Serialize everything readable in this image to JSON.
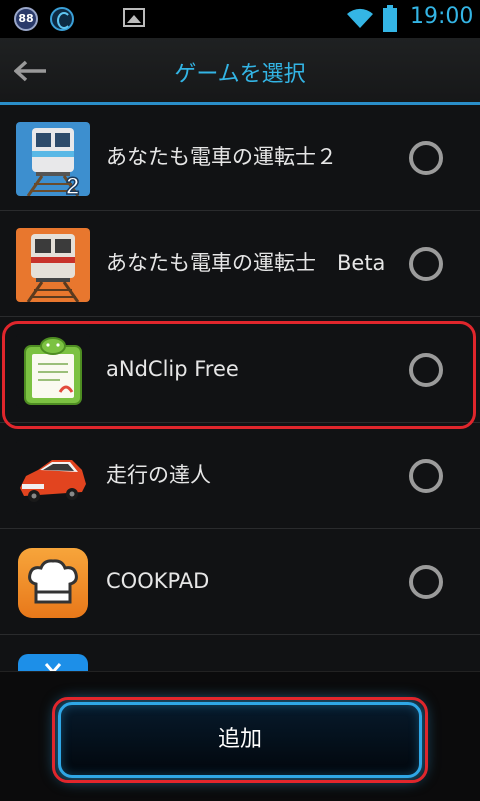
{
  "status_bar": {
    "badge": "88",
    "time": "19:00",
    "icons": [
      "app-badge-icon",
      "app-swirl-icon",
      "image-icon",
      "wifi-icon",
      "battery-icon"
    ]
  },
  "header": {
    "title": "ゲームを選択",
    "back_icon": "back-arrow-icon"
  },
  "games": [
    {
      "label": "あなたも電車の運転士２",
      "icon": "train-2-icon",
      "selected": false
    },
    {
      "label": "あなたも電車の運転士　Beta",
      "icon": "train-beta-icon",
      "selected": false
    },
    {
      "label": "aNdClip Free",
      "icon": "clipboard-icon",
      "selected": false
    },
    {
      "label": "走行の達人",
      "icon": "car-icon",
      "selected": false,
      "highlighted": true
    },
    {
      "label": "COOKPAD",
      "icon": "chef-hat-icon",
      "selected": false
    }
  ],
  "footer": {
    "add_label": "追加"
  },
  "colors": {
    "accent": "#33b5e5",
    "highlight": "#e0262c"
  }
}
